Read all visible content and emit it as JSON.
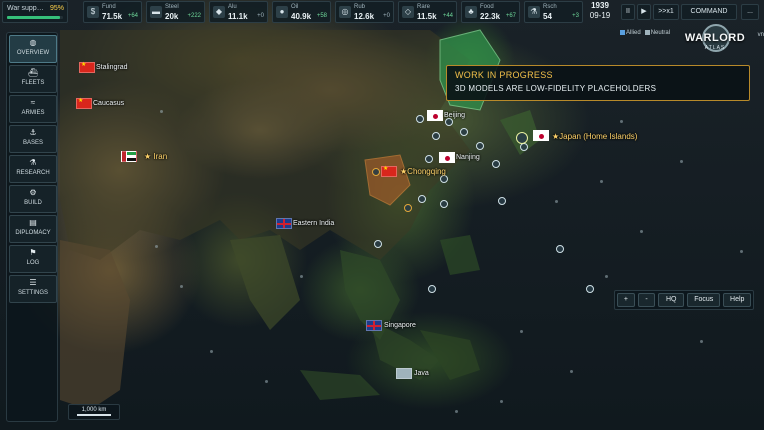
{
  "topbar": {
    "war_support": {
      "label": "War supp…",
      "value": "95%",
      "fraction": 0.95
    },
    "resources": [
      {
        "name": "Fund",
        "value": "71.5k",
        "delta": "+64",
        "icon": "coin-icon"
      },
      {
        "name": "Steel",
        "value": "20k",
        "delta": "+222",
        "icon": "ingot-icon"
      },
      {
        "name": "Alu",
        "value": "11.1k",
        "delta": "+0",
        "icon": "cube-icon"
      },
      {
        "name": "Oil",
        "value": "40.9k",
        "delta": "+58",
        "icon": "oil-drop-icon"
      },
      {
        "name": "Rub",
        "value": "12.6k",
        "delta": "+0",
        "icon": "tire-icon"
      },
      {
        "name": "Rare",
        "value": "11.5k",
        "delta": "+44",
        "icon": "gem-icon"
      },
      {
        "name": "Food",
        "value": "22.3k",
        "delta": "+67",
        "icon": "wheat-icon"
      },
      {
        "name": "Rsch",
        "value": "54",
        "delta": "+3",
        "icon": "flask-icon"
      }
    ],
    "date": {
      "year": "1939",
      "month_day": "09-19"
    },
    "controls": {
      "pause": "II",
      "play": "▶",
      "speed": ">>x1",
      "command": "COMMAND",
      "more": "..."
    }
  },
  "legend": {
    "allied": "Allied",
    "neutral": "Neutral",
    "allied_color": "#5aa0e0",
    "neutral_color": "#9fb3bc"
  },
  "logo": {
    "title": "WARLORD",
    "subtitle": "ATLAS",
    "suffix": "vn"
  },
  "sidenav": [
    {
      "label": "OVERVIEW",
      "icon": "globe-icon",
      "glyph": "◍",
      "active": true
    },
    {
      "label": "FLEETS",
      "icon": "ship-icon",
      "glyph": "⛴",
      "active": false
    },
    {
      "label": "ARMIES",
      "icon": "chevrons-icon",
      "glyph": "≈",
      "active": false
    },
    {
      "label": "BASES",
      "icon": "anchor-icon",
      "glyph": "⚓",
      "active": false
    },
    {
      "label": "RESEARCH",
      "icon": "flask-icon",
      "glyph": "⚗",
      "active": false
    },
    {
      "label": "BUILD",
      "icon": "gear-icon",
      "glyph": "⚙",
      "active": false
    },
    {
      "label": "DIPLOMACY",
      "icon": "document-icon",
      "glyph": "▤",
      "active": false
    },
    {
      "label": "LOG",
      "icon": "flag-icon",
      "glyph": "⚑",
      "active": false
    },
    {
      "label": "SETTINGS",
      "icon": "sliders-icon",
      "glyph": "☰",
      "active": false
    }
  ],
  "banner": {
    "title": "WORK IN PROGRESS",
    "message": "3D MODELS ARE LOW-FIDELITY PLACEHOLDERS"
  },
  "map_labels": {
    "stalingrad": "Stalingrad",
    "caucasus": "Caucasus",
    "iran": "★ Iran",
    "chongqing": "★Chongqing",
    "beijing": "Beijing",
    "nanjing": "Nanjing",
    "japan": "★Japan (Home Islands)",
    "eastern_india": "Eastern India",
    "singapore": "Singapore",
    "java": "Java"
  },
  "map_controls": {
    "zoom_in": "+",
    "zoom_out": "-",
    "hq": "HQ",
    "focus": "Focus",
    "help": "Help"
  },
  "scale": {
    "label": "1,000 km"
  }
}
